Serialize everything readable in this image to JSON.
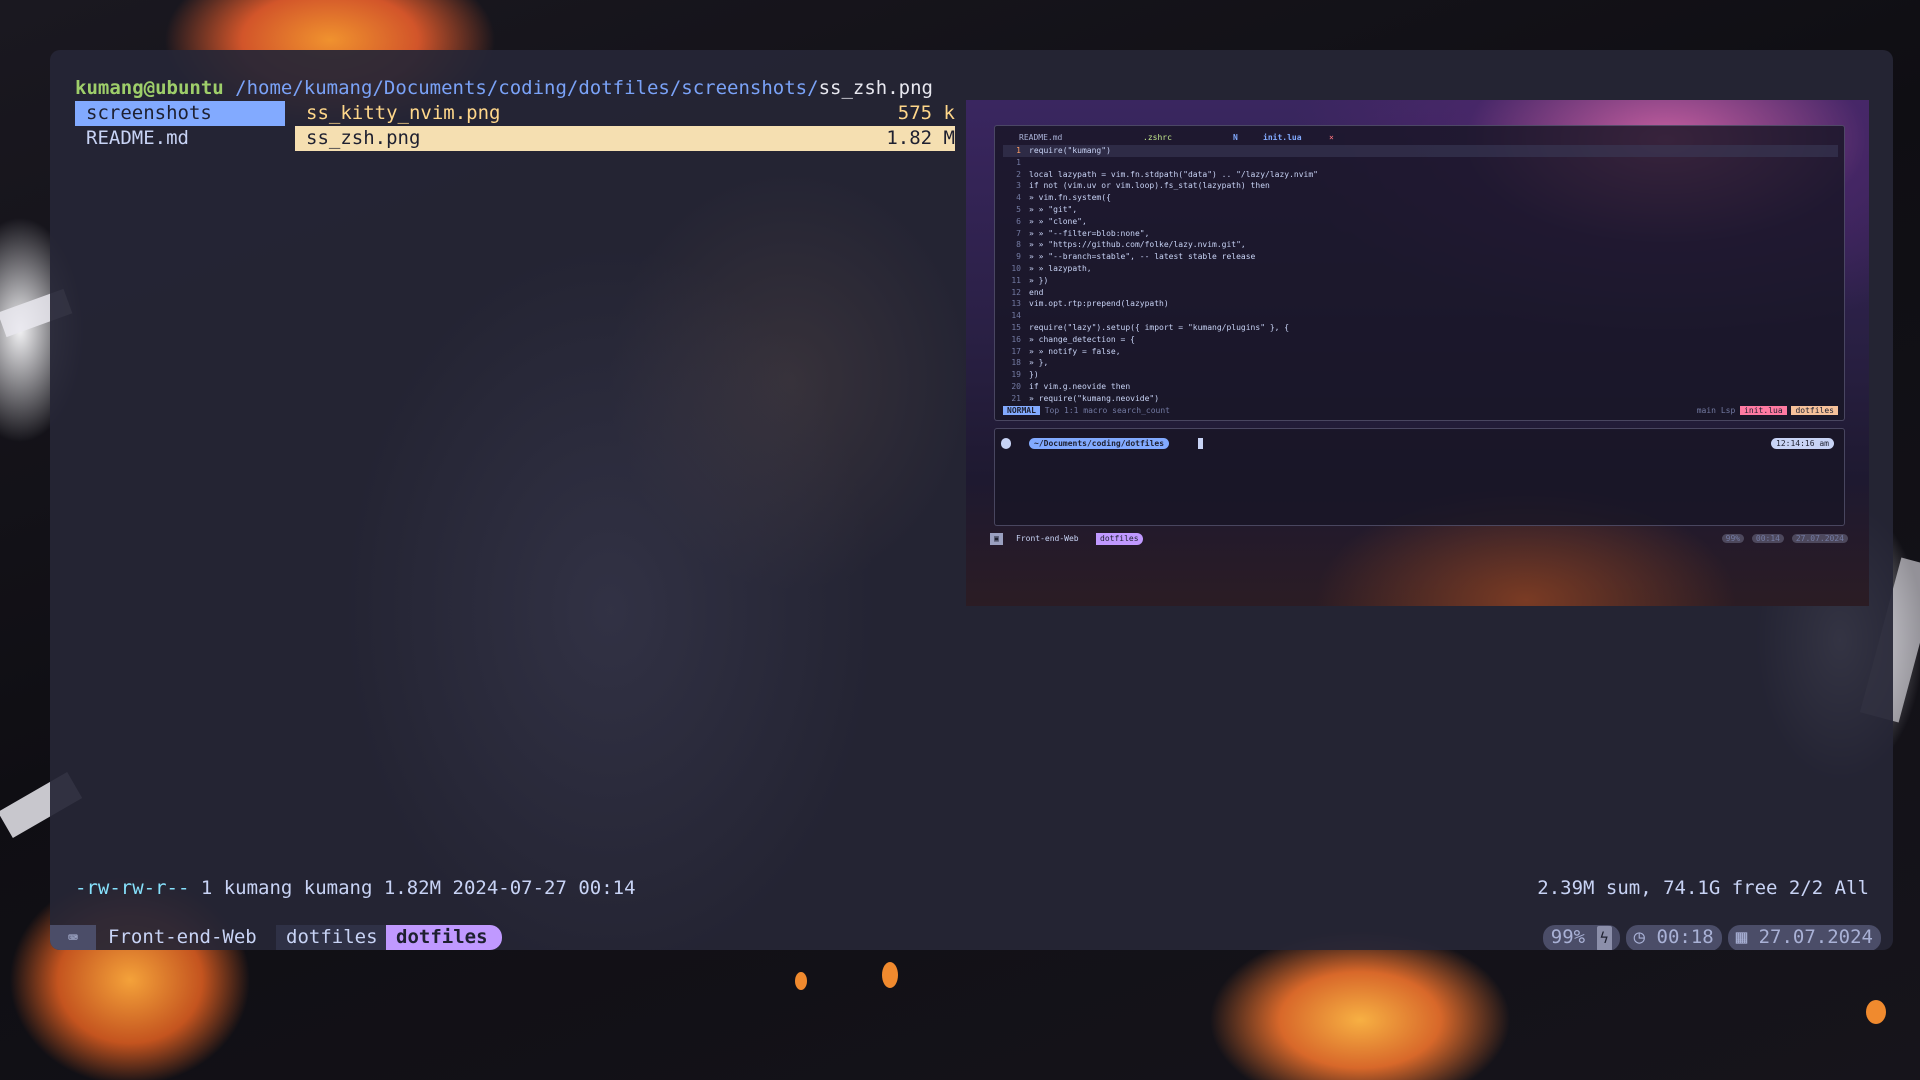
{
  "prompt": {
    "user_host": "kumang@ubuntu",
    "path": "/home/kumang/Documents/coding/dotfiles/screenshots/",
    "file": "ss_zsh.png"
  },
  "parent_pane": {
    "items": [
      {
        "label": "screenshots",
        "selected": true
      },
      {
        "label": "README.md",
        "selected": false
      }
    ]
  },
  "current_pane": {
    "items": [
      {
        "name": "ss_kitty_nvim.png",
        "size": "575 k"
      },
      {
        "name": "ss_zsh.png",
        "size": "1.82 M"
      }
    ]
  },
  "preview": {
    "tabs": {
      "t1": "README.md",
      "t2": ".zshrc",
      "t3": "N",
      "t4": "init.lua",
      "close": "×"
    },
    "code": [
      {
        "n": "1",
        "t": "require(\"kumang\")"
      },
      {
        "n": "1",
        "t": ""
      },
      {
        "n": "2",
        "t": "local lazypath = vim.fn.stdpath(\"data\") .. \"/lazy/lazy.nvim\""
      },
      {
        "n": "3",
        "t": "if not (vim.uv or vim.loop).fs_stat(lazypath) then"
      },
      {
        "n": "4",
        "t": "» vim.fn.system({"
      },
      {
        "n": "5",
        "t": "» » \"git\","
      },
      {
        "n": "6",
        "t": "» » \"clone\","
      },
      {
        "n": "7",
        "t": "» » \"--filter=blob:none\","
      },
      {
        "n": "8",
        "t": "» » \"https://github.com/folke/lazy.nvim.git\","
      },
      {
        "n": "9",
        "t": "» » \"--branch=stable\", -- latest stable release"
      },
      {
        "n": "10",
        "t": "» » lazypath,"
      },
      {
        "n": "11",
        "t": "» })"
      },
      {
        "n": "12",
        "t": "end"
      },
      {
        "n": "13",
        "t": "vim.opt.rtp:prepend(lazypath)"
      },
      {
        "n": "14",
        "t": ""
      },
      {
        "n": "15",
        "t": "require(\"lazy\").setup({ import = \"kumang/plugins\" }, {"
      },
      {
        "n": "16",
        "t": "» change_detection = {"
      },
      {
        "n": "17",
        "t": "» » notify = false,"
      },
      {
        "n": "18",
        "t": "» },"
      },
      {
        "n": "19",
        "t": "})"
      },
      {
        "n": "20",
        "t": "if vim.g.neovide then"
      },
      {
        "n": "21",
        "t": "» require(\"kumang.neovide\")"
      }
    ],
    "status": {
      "mode": "NORMAL",
      "info": "Top 1:1 macro search_count",
      "branch": "main",
      "lsp": "Lsp",
      "file": "init.lua",
      "dir": "dotfiles"
    },
    "terminal": {
      "os": "",
      "dir": "~/Documents/coding/dotfiles",
      "check": "✔",
      "time": "12:14:16 am"
    },
    "tmux": {
      "session": "Front-end-Web",
      "window": "dotfiles",
      "battery": "99%",
      "clock": "00:14",
      "date": "27.07.2024"
    }
  },
  "file_info": {
    "perm": "-rw-rw-r--",
    "details": "1 kumang kumang 1.82M 2024-07-27 00:14"
  },
  "dir_summary": "2.39M sum, 74.1G free  2/2  All",
  "tmux_bar": {
    "session": "Front-end-Web",
    "window_1": "dotfiles",
    "window_2": "dotfiles",
    "battery": "99%",
    "clock": "00:18",
    "date": "27.07.2024"
  },
  "colors": {
    "accent_blue": "#82aaff",
    "accent_purple": "#c099ff",
    "highlight": "#f5dfb1",
    "user_green": "#9ece6a"
  }
}
